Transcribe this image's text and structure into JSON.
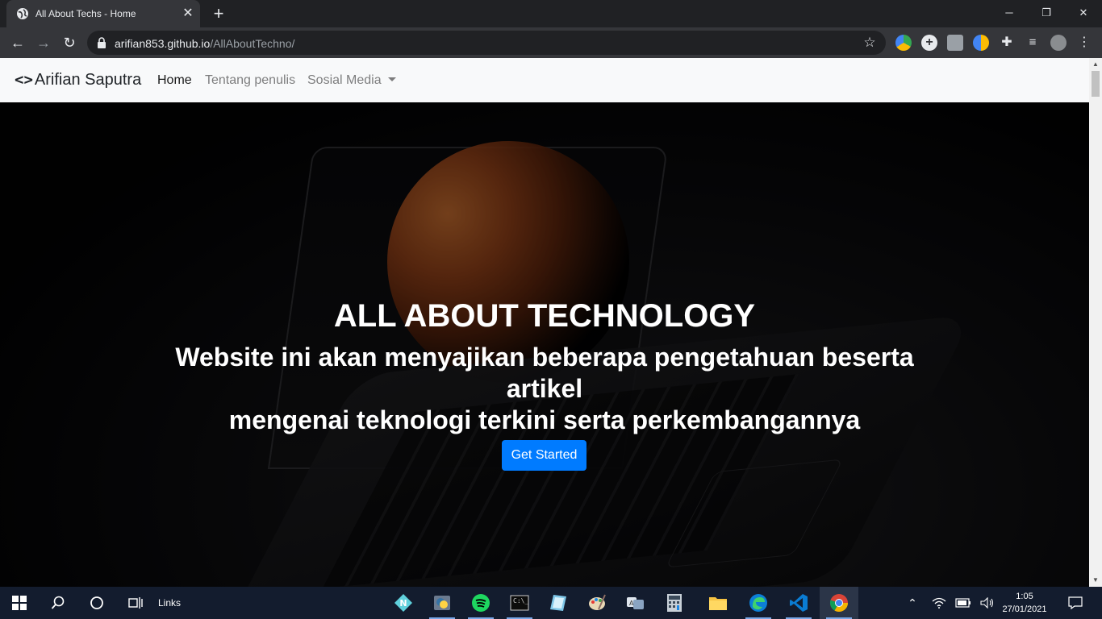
{
  "browser": {
    "tab_title": "All About Techs - Home",
    "url_host": "arifian853.github.io",
    "url_path": "/AllAboutTechno/"
  },
  "navbar": {
    "brand": "Arifian Saputra",
    "brand_icon": "<>",
    "links": [
      {
        "label": "Home",
        "active": true
      },
      {
        "label": "Tentang penulis",
        "active": false
      },
      {
        "label": "Sosial Media",
        "active": false,
        "dropdown": true
      }
    ]
  },
  "hero": {
    "title": "ALL ABOUT TECHNOLOGY",
    "subtitle_line1": "Website ini akan menyajikan beberapa pengetahuan beserta artikel",
    "subtitle_line2": "mengenai teknologi terkini serta perkembangannya",
    "cta_label": "Get Started"
  },
  "taskbar": {
    "links_label": "Links",
    "time": "1:05",
    "date": "27/01/2021",
    "pinned_apps": [
      "start-icon",
      "search-icon",
      "cortana-icon",
      "task-view-icon",
      "n-app-icon",
      "python-icon",
      "spotify-icon",
      "terminal-icon",
      "notes-icon",
      "paint-icon",
      "translator-icon",
      "calculator-icon",
      "file-explorer-icon",
      "edge-icon",
      "vscode-icon",
      "chrome-icon"
    ]
  },
  "colors": {
    "primary": "#007bff",
    "navbar_bg": "#f8f9fa",
    "chrome_dark": "#202124",
    "taskbar": "#131c2e"
  }
}
